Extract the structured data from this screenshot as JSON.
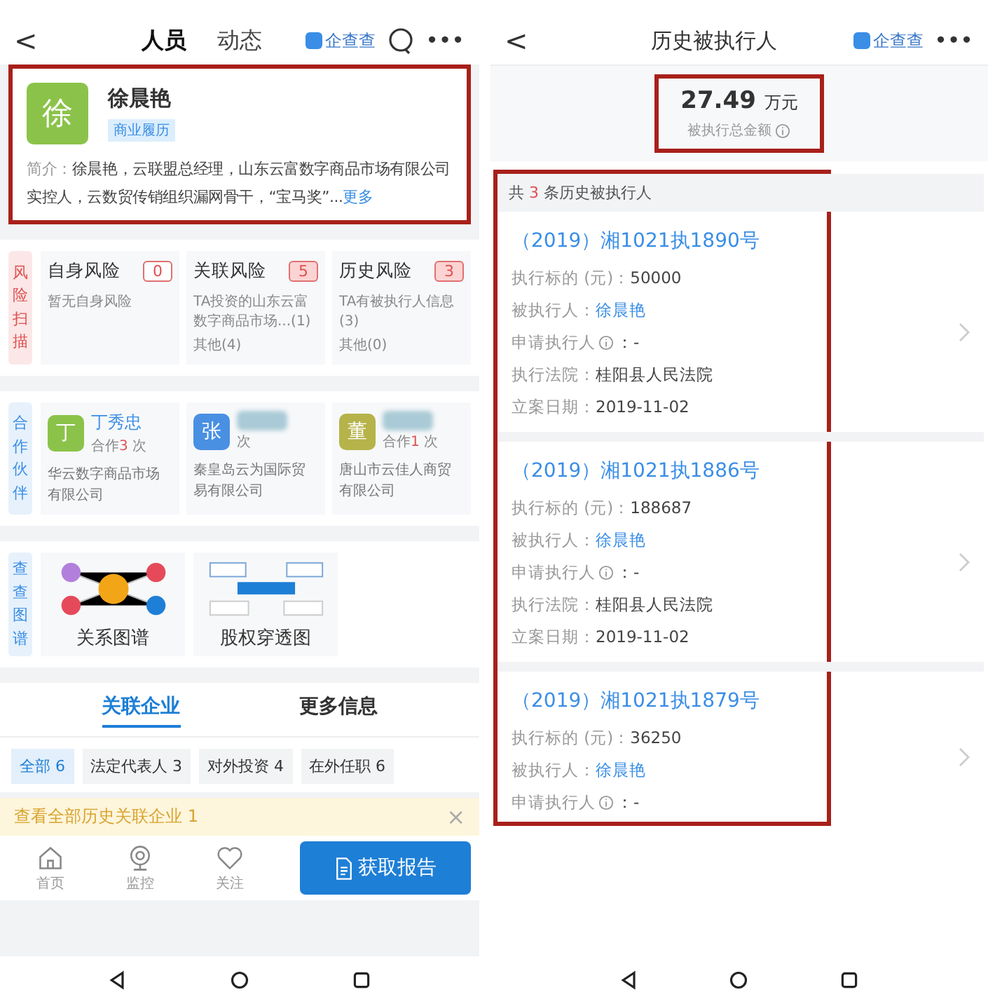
{
  "left": {
    "nav": {
      "back": "<",
      "tabs": [
        {
          "label": "人员",
          "selected": true
        },
        {
          "label": "动态",
          "selected": false
        }
      ],
      "brand": "企查查",
      "more": "•••"
    },
    "profile": {
      "highlighted": true,
      "avatar": "徐",
      "name": "徐晨艳",
      "tag": "商业履历",
      "intro_label": "简介：",
      "intro": "徐晨艳，云联盟总经理，山东云富数字商品市场有限公司实控人，云数贸传销组织漏网骨干，“宝马奖”...",
      "more": "更多"
    },
    "risk": {
      "label": "风险扫描",
      "cards": [
        {
          "title": "自身风险",
          "count": "0",
          "alert": false,
          "lines": [
            "暂无自身风险"
          ]
        },
        {
          "title": "关联风险",
          "count": "5",
          "alert": true,
          "lines": [
            "TA投资的山东云富数字商品市场...(1)",
            "其他(4)"
          ]
        },
        {
          "title": "历史风险",
          "count": "3",
          "alert": true,
          "lines": [
            "TA有被执行人信息(3)",
            "其他(0)"
          ]
        }
      ]
    },
    "partners": {
      "label": "合作伙伴",
      "items": [
        {
          "avatar": "丁",
          "color": "#8bc34a",
          "name": "丁秀忠",
          "redacted": false,
          "coop_prefix": "合作",
          "coop_count": "3",
          "coop_suffix": "次",
          "company": "华云数字商品市场有限公司"
        },
        {
          "avatar": "张",
          "color": "#4a90e2",
          "redacted": true,
          "coop_suffix": "次",
          "company": "秦皇岛云为国际贸易有限公司"
        },
        {
          "avatar": "董",
          "color": "#b5b34a",
          "redacted": true,
          "coop_prefix": "合作",
          "coop_count": "1",
          "coop_suffix": "次",
          "company": "唐山市云佳人商贸有限公司"
        }
      ]
    },
    "graphs": {
      "label": "查查图谱",
      "items": [
        {
          "kind": "relation",
          "title": "关系图谱"
        },
        {
          "kind": "equity",
          "title": "股权穿透图"
        }
      ]
    },
    "section_tabs": [
      {
        "label": "关联企业",
        "selected": true
      },
      {
        "label": "更多信息",
        "selected": false
      }
    ],
    "chips": [
      {
        "label": "全部 6",
        "selected": true
      },
      {
        "label": "法定代表人 3",
        "selected": false
      },
      {
        "label": "对外投资 4",
        "selected": false
      },
      {
        "label": "在外任职 6",
        "selected": false
      }
    ],
    "banner": {
      "text": "查看全部历史关联企业 1",
      "close": "×"
    },
    "bottom_bar": {
      "items": [
        {
          "kind": "home",
          "label": "首页"
        },
        {
          "kind": "monitor",
          "label": "监控"
        },
        {
          "kind": "follow",
          "label": "关注"
        }
      ],
      "report_button": "获取报告"
    }
  },
  "right": {
    "nav": {
      "back": "<",
      "title": "历史被执行人",
      "brand": "企查查",
      "more": "•••"
    },
    "summary": {
      "highlighted": true,
      "amount": "27.49",
      "unit": "万元",
      "caption": "被执行总金额"
    },
    "list": {
      "highlighted": true,
      "header_prefix": "共",
      "header_count": "3",
      "header_suffix": "条历史被执行人",
      "cases": [
        {
          "title": "（2019）湘1021执1890号",
          "fields": [
            {
              "kind": "text",
              "label": "执行标的 (元)：",
              "value": "50000"
            },
            {
              "kind": "person",
              "label": "被执行人：",
              "value": "徐晨艳"
            },
            {
              "kind": "info",
              "label": "申请执行人",
              "value": "：-"
            },
            {
              "kind": "text",
              "label": "执行法院：",
              "value": "桂阳县人民法院"
            },
            {
              "kind": "text",
              "label": "立案日期：",
              "value": "2019-11-02"
            }
          ]
        },
        {
          "title": "（2019）湘1021执1886号",
          "fields": [
            {
              "kind": "text",
              "label": "执行标的 (元)：",
              "value": "188687"
            },
            {
              "kind": "person",
              "label": "被执行人：",
              "value": "徐晨艳"
            },
            {
              "kind": "info",
              "label": "申请执行人",
              "value": "：-"
            },
            {
              "kind": "text",
              "label": "执行法院：",
              "value": "桂阳县人民法院"
            },
            {
              "kind": "text",
              "label": "立案日期：",
              "value": "2019-11-02"
            }
          ]
        },
        {
          "title": "（2019）湘1021执1879号",
          "fields": [
            {
              "kind": "text",
              "label": "执行标的 (元)：",
              "value": "36250"
            },
            {
              "kind": "person",
              "label": "被执行人：",
              "value": "徐晨艳"
            },
            {
              "kind": "info",
              "label": "申请执行人",
              "value": "：-"
            }
          ]
        }
      ]
    }
  }
}
